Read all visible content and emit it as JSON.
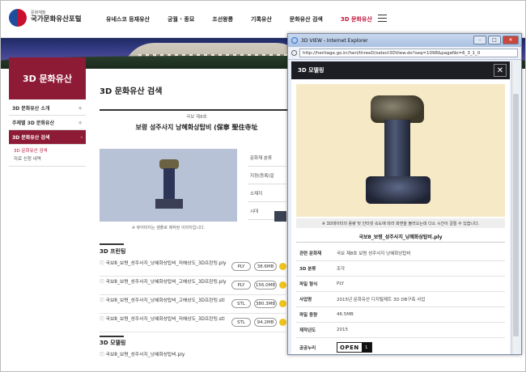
{
  "logo": {
    "line1": "문화재청",
    "line2": "국가문화유산포털"
  },
  "nav": [
    {
      "label": "유네스코 등재유산"
    },
    {
      "label": "궁궐 · 종묘"
    },
    {
      "label": "조선왕릉"
    },
    {
      "label": "기록유산"
    },
    {
      "label": "문화유산 검색"
    },
    {
      "label": "3D 문화유산"
    }
  ],
  "sidebar": {
    "title": "3D 문화유산",
    "items": [
      {
        "label": "3D 문화유산 소개",
        "mark": "+"
      },
      {
        "label": "주제별 3D 문화유산",
        "mark": "+"
      },
      {
        "label": "3D 문화유산 검색",
        "mark": "-"
      }
    ],
    "subitems": [
      {
        "label": "3D 문화유산 검색"
      },
      {
        "label": "자료 신청 내역"
      }
    ]
  },
  "main": {
    "title": "3D 문화유산 검색",
    "treasure_no": "국보 제8호",
    "treasure_name": "보령 성주사지 낭혜화상탑비 (保寧 聖住寺址",
    "preview_caption": "※ 뷰어미지는 샘플로 제작된 이미지입니다.",
    "info_labels": [
      "문화재 분류",
      "지정(등록)일",
      "소재지",
      "시대"
    ],
    "sec_3d_print": "3D 프린팅",
    "sec_3d_model": "3D 모델링",
    "files": [
      {
        "name": "국보8_보령_성주사지_낭혜화상탑비_저해상도_3D프린팅.ply",
        "format": "PLY",
        "size": "38.6MB"
      },
      {
        "name": "국보8_보령_성주사지_낭혜화상탑비_고해상도_3D프린팅.ply",
        "format": "PLY",
        "size": "156.0MB"
      },
      {
        "name": "국보8_보령_성주사지_낭혜화상탑비_고해상도_3D프린팅.stl",
        "format": "STL",
        "size": "380.3MB"
      },
      {
        "name": "국보8_보령_성주사지_낭혜화상탑비_저해상도_3D프린팅.stl",
        "format": "STL",
        "size": "94.2MB"
      }
    ],
    "model_file": "국보8_보령_성주사지_낭혜화상탑비.ply"
  },
  "popup": {
    "window_title": "3D VIEW - Internet Explorer",
    "url": "http://heritage.go.kr/heri/threeD/select3DView.do?seq=1098&pageNo=6_3_1_0",
    "header": "3D 모델링",
    "note": "※ 3D데이터의 용량 및 인터넷 속도에 따라 화면을 불러오는데 다소 시간이 걸릴 수 있습니다.",
    "file_title": "국보8_보령_성주사지_낭혜화상탑비.ply",
    "meta": [
      {
        "key": "관련 문화재",
        "value": "국보 제8호 보령 성주사지 낭혜화상탑비"
      },
      {
        "key": "3D 분류",
        "value": "조각"
      },
      {
        "key": "파일 형식",
        "value": "PLY"
      },
      {
        "key": "사업명",
        "value": "2015년 문화유산 디지털제트 3D DB구축 사업"
      },
      {
        "key": "파일 용량",
        "value": "46.5MB"
      },
      {
        "key": "제작년도",
        "value": "2015"
      }
    ],
    "license_label": "공공누리",
    "license_badge": "OPEN",
    "license_type": "1"
  },
  "colors": {
    "brand": "#8e1b36",
    "active_nav": "#c0143c"
  }
}
